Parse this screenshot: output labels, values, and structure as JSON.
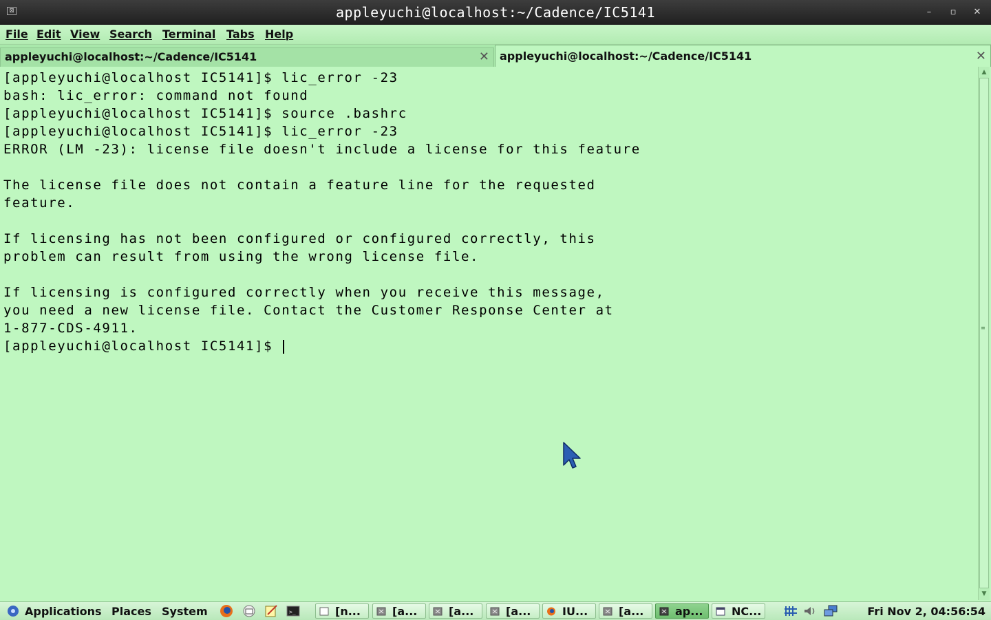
{
  "window": {
    "title": "appleyuchi@localhost:~/Cadence/IC5141",
    "minimize_glyph": "–",
    "maximize_glyph": "▫",
    "close_glyph": "✕"
  },
  "menu": {
    "file": "File",
    "edit": "Edit",
    "view": "View",
    "search": "Search",
    "terminal": "Terminal",
    "tabs": "Tabs",
    "help": "Help"
  },
  "tabs": [
    {
      "label": "appleyuchi@localhost:~/Cadence/IC5141",
      "active": false
    },
    {
      "label": "appleyuchi@localhost:~/Cadence/IC5141",
      "active": true
    }
  ],
  "terminal": {
    "lines": [
      "[appleyuchi@localhost IC5141]$ lic_error -23",
      "bash: lic_error: command not found",
      "[appleyuchi@localhost IC5141]$ source .bashrc",
      "[appleyuchi@localhost IC5141]$ lic_error -23",
      "ERROR (LM -23): license file doesn't include a license for this feature",
      "",
      "The license file does not contain a feature line for the requested",
      "feature.",
      "",
      "If licensing has not been configured or configured correctly, this",
      "problem can result from using the wrong license file.",
      "",
      "If licensing is configured correctly when you receive this message,",
      "you need a new license file. Contact the Customer Response Center at",
      "1-877-CDS-4911.",
      "[appleyuchi@localhost IC5141]$ "
    ]
  },
  "panel": {
    "applications": "Applications",
    "places": "Places",
    "system": "System",
    "launchers": [
      "firefox-icon",
      "mail-icon",
      "text-editor-icon",
      "terminal-icon"
    ],
    "tasks": [
      {
        "label": "[n...",
        "icon": "notes-icon"
      },
      {
        "label": "[a...",
        "icon": "terminal-icon"
      },
      {
        "label": "[a...",
        "icon": "terminal-icon"
      },
      {
        "label": "[a...",
        "icon": "terminal-icon"
      },
      {
        "label": "IU...",
        "icon": "firefox-icon"
      },
      {
        "label": "[a...",
        "icon": "terminal-icon"
      },
      {
        "label": "ap...",
        "icon": "terminal-icon",
        "active": true
      },
      {
        "label": "NC...",
        "icon": "window-icon"
      }
    ],
    "clock": "Fri Nov  2, 04:56:54"
  },
  "colors": {
    "terminal_bg": "#bff7c0",
    "titlebar_bg": "#2a2a2a",
    "text": "#000000"
  }
}
